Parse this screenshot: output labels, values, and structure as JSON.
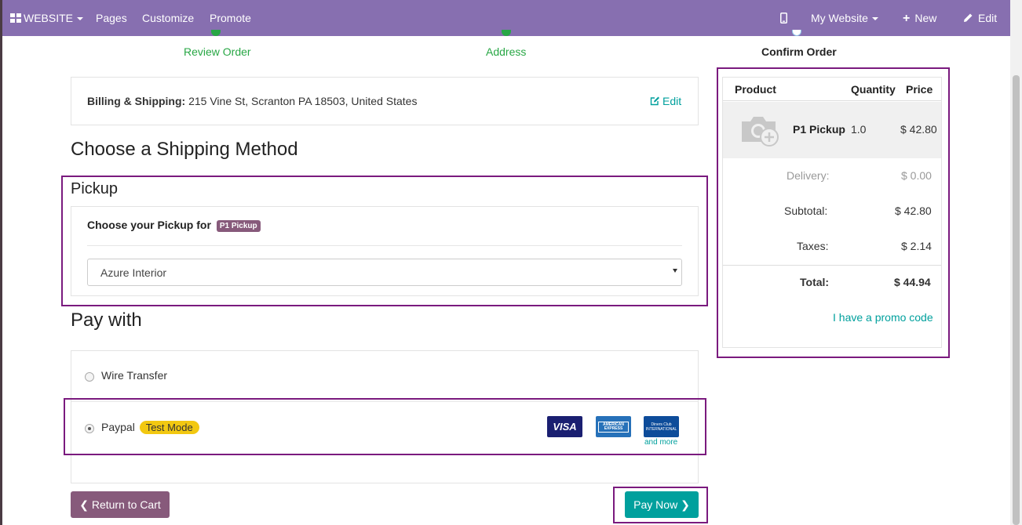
{
  "topbar": {
    "brand": "WEBSITE",
    "menu": [
      "Pages",
      "Customize",
      "Promote"
    ],
    "website_selector": "My Website",
    "new_label": "New",
    "edit_label": "Edit",
    "color": "#876fb0"
  },
  "steps": [
    {
      "label": "Review Order",
      "state": "done"
    },
    {
      "label": "Address",
      "state": "done"
    },
    {
      "label": "Confirm Order",
      "state": "current"
    }
  ],
  "billing": {
    "label": "Billing & Shipping:",
    "address": "215 Vine St, Scranton PA 18503, United States",
    "edit_label": "Edit"
  },
  "shipping": {
    "heading": "Choose a Shipping Method",
    "method_title": "Pickup",
    "choose_label": "Choose your Pickup for",
    "product_badge": "P1 Pickup",
    "selected_location": "Azure Interior"
  },
  "payment": {
    "heading": "Pay with",
    "options": [
      {
        "label": "Wire Transfer",
        "selected": false
      },
      {
        "label": "Paypal",
        "selected": true,
        "badge": "Test Mode"
      }
    ],
    "cards": [
      "VISA",
      "AMERICAN EXPRESS",
      "Diners Club INTERNATIONAL"
    ],
    "more_label": "and more"
  },
  "buttons": {
    "return_label": "Return to Cart",
    "pay_label": "Pay Now"
  },
  "summary": {
    "headers": {
      "product": "Product",
      "quantity": "Quantity",
      "price": "Price"
    },
    "line": {
      "name": "P1 Pickup",
      "quantity": "1.0",
      "price": "$ 42.80"
    },
    "delivery_label": "Delivery:",
    "delivery_value": "$ 0.00",
    "subtotal_label": "Subtotal:",
    "subtotal_value": "$ 42.80",
    "taxes_label": "Taxes:",
    "taxes_value": "$ 2.14",
    "total_label": "Total:",
    "total_value": "$ 44.94",
    "promo_label": "I have a promo code"
  },
  "colors": {
    "primary": "#875a7b",
    "accent": "#00a09d",
    "success": "#28a745",
    "highlight": "#7a1a7e"
  }
}
